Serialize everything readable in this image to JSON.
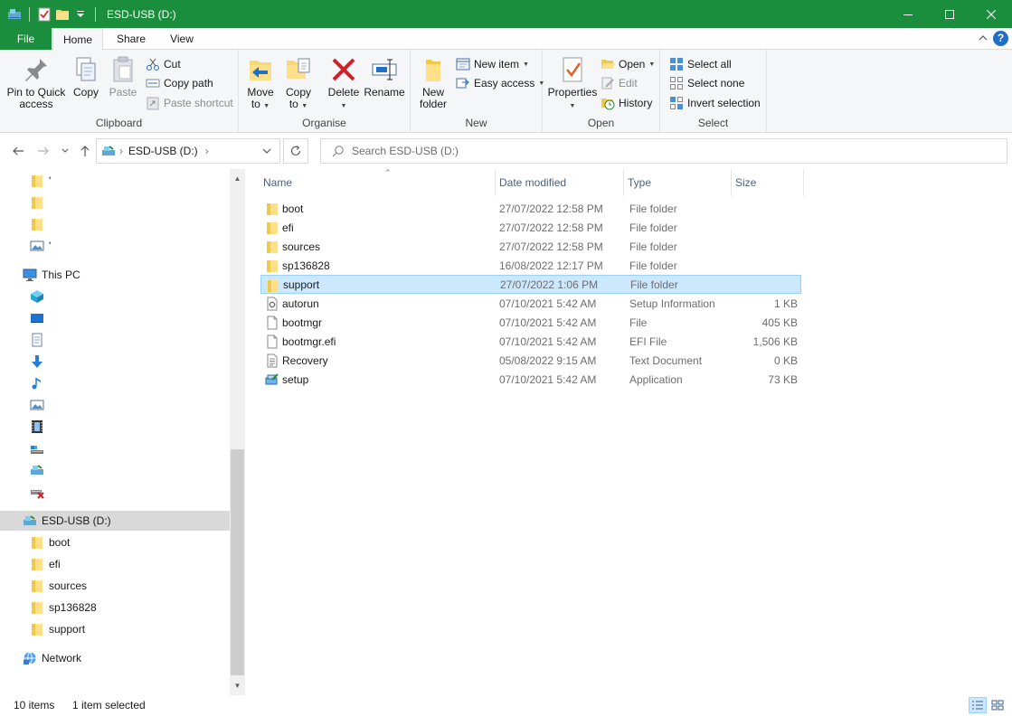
{
  "window": {
    "title": "ESD-USB (D:)",
    "accent": "#1a8e3c"
  },
  "ribbon_tabs": [
    {
      "label": "File"
    },
    {
      "label": "Home"
    },
    {
      "label": "Share"
    },
    {
      "label": "View"
    }
  ],
  "ribbon": {
    "clipboard": {
      "label": "Clipboard",
      "pin": "Pin to Quick access",
      "pin_line1": "Pin to Quick",
      "pin_line2": "access",
      "copy": "Copy",
      "paste": "Paste",
      "cut": "Cut",
      "copy_path": "Copy path",
      "paste_shortcut": "Paste shortcut"
    },
    "organise": {
      "label": "Organise",
      "move_line1": "Move",
      "move_line2": "to",
      "copy_line1": "Copy",
      "copy_line2": "to",
      "delete": "Delete",
      "rename": "Rename"
    },
    "new": {
      "label": "New",
      "folder_line1": "New",
      "folder_line2": "folder",
      "new_item": "New item",
      "easy_access": "Easy access"
    },
    "open": {
      "label": "Open",
      "properties": "Properties",
      "open": "Open",
      "edit": "Edit",
      "history": "History"
    },
    "select": {
      "label": "Select",
      "select_all": "Select all",
      "select_none": "Select none",
      "invert": "Invert selection"
    }
  },
  "address": {
    "path": "ESD-USB (D:)",
    "search_placeholder": "Search ESD-USB (D:)"
  },
  "nav": {
    "quick_items": [
      "'",
      "",
      "",
      "'"
    ],
    "this_pc": "This PC",
    "drive": "ESD-USB (D:)",
    "drive_children": [
      "boot",
      "efi",
      "sources",
      "sp136828",
      "support"
    ],
    "network": "Network"
  },
  "columns": {
    "name": "Name",
    "date": "Date modified",
    "type": "Type",
    "size": "Size"
  },
  "files": [
    {
      "name": "boot",
      "date": "27/07/2022 12:58 PM",
      "type": "File folder",
      "size": "",
      "icon": "folder-icon"
    },
    {
      "name": "efi",
      "date": "27/07/2022 12:58 PM",
      "type": "File folder",
      "size": "",
      "icon": "folder-icon"
    },
    {
      "name": "sources",
      "date": "27/07/2022 12:58 PM",
      "type": "File folder",
      "size": "",
      "icon": "folder-icon"
    },
    {
      "name": "sp136828",
      "date": "16/08/2022 12:17 PM",
      "type": "File folder",
      "size": "",
      "icon": "folder-icon"
    },
    {
      "name": "support",
      "date": "27/07/2022 1:06 PM",
      "type": "File folder",
      "size": "",
      "icon": "folder-icon"
    },
    {
      "name": "autorun",
      "date": "07/10/2021 5:42 AM",
      "type": "Setup Information",
      "size": "1 KB",
      "icon": "settings-file-icon"
    },
    {
      "name": "bootmgr",
      "date": "07/10/2021 5:42 AM",
      "type": "File",
      "size": "405 KB",
      "icon": "file-icon"
    },
    {
      "name": "bootmgr.efi",
      "date": "07/10/2021 5:42 AM",
      "type": "EFI File",
      "size": "1,506 KB",
      "icon": "file-icon"
    },
    {
      "name": "Recovery",
      "date": "05/08/2022 9:15 AM",
      "type": "Text Document",
      "size": "0 KB",
      "icon": "text-file-icon"
    },
    {
      "name": "setup",
      "date": "07/10/2021 5:42 AM",
      "type": "Application",
      "size": "73 KB",
      "icon": "setup-app-icon"
    }
  ],
  "selected_index": 4,
  "status": {
    "count": "10 items",
    "selection": "1 item selected"
  }
}
